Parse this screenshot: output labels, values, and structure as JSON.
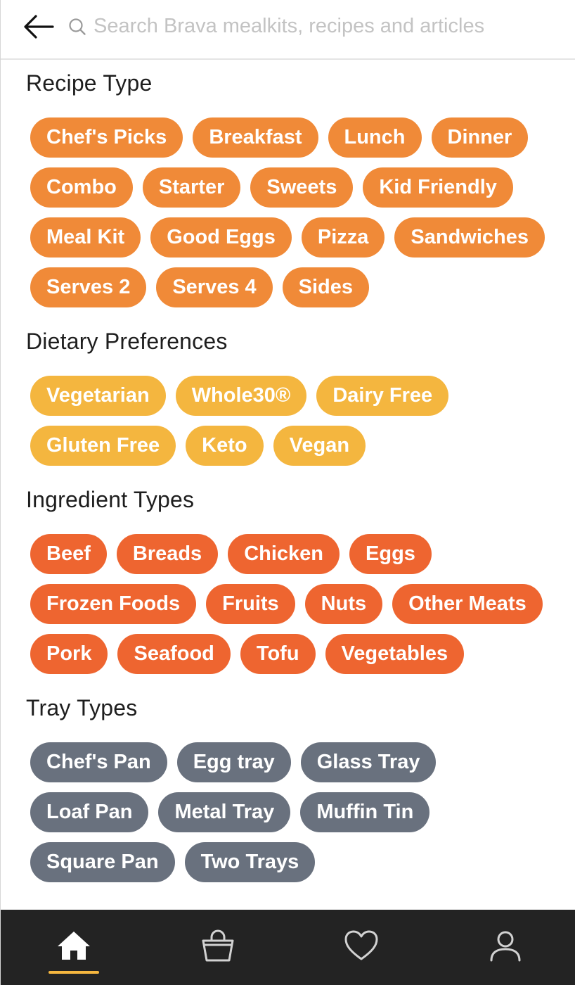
{
  "search": {
    "placeholder": "Search Brava mealkits, recipes and articles"
  },
  "sections": {
    "recipe_type": {
      "title": "Recipe Type",
      "color": "#F08A38",
      "chips": [
        "Chef's Picks",
        "Breakfast",
        "Lunch",
        "Dinner",
        "Combo",
        "Starter",
        "Sweets",
        "Kid Friendly",
        "Meal Kit",
        "Good Eggs",
        "Pizza",
        "Sandwiches",
        "Serves 2",
        "Serves 4",
        "Sides"
      ]
    },
    "dietary_preferences": {
      "title": "Dietary Preferences",
      "color": "#F4B63F",
      "chips": [
        "Vegetarian",
        "Whole30®",
        "Dairy Free",
        "Gluten Free",
        "Keto",
        "Vegan"
      ]
    },
    "ingredient_types": {
      "title": "Ingredient Types",
      "color": "#EE6530",
      "chips": [
        "Beef",
        "Breads",
        "Chicken",
        "Eggs",
        "Frozen Foods",
        "Fruits",
        "Nuts",
        "Other Meats",
        "Pork",
        "Seafood",
        "Tofu",
        "Vegetables"
      ]
    },
    "tray_types": {
      "title": "Tray Types",
      "color": "#69717E",
      "chips": [
        "Chef's Pan",
        "Egg tray",
        "Glass Tray",
        "Loaf Pan",
        "Metal Tray",
        "Muffin Tin",
        "Square Pan",
        "Two Trays"
      ]
    }
  },
  "bottom_nav": {
    "background": "#232323",
    "active_indicator_color": "#F4B63F",
    "items": [
      {
        "icon": "home-icon",
        "active": true
      },
      {
        "icon": "basket-icon",
        "active": false
      },
      {
        "icon": "heart-icon",
        "active": false
      },
      {
        "icon": "user-icon",
        "active": false
      }
    ]
  }
}
